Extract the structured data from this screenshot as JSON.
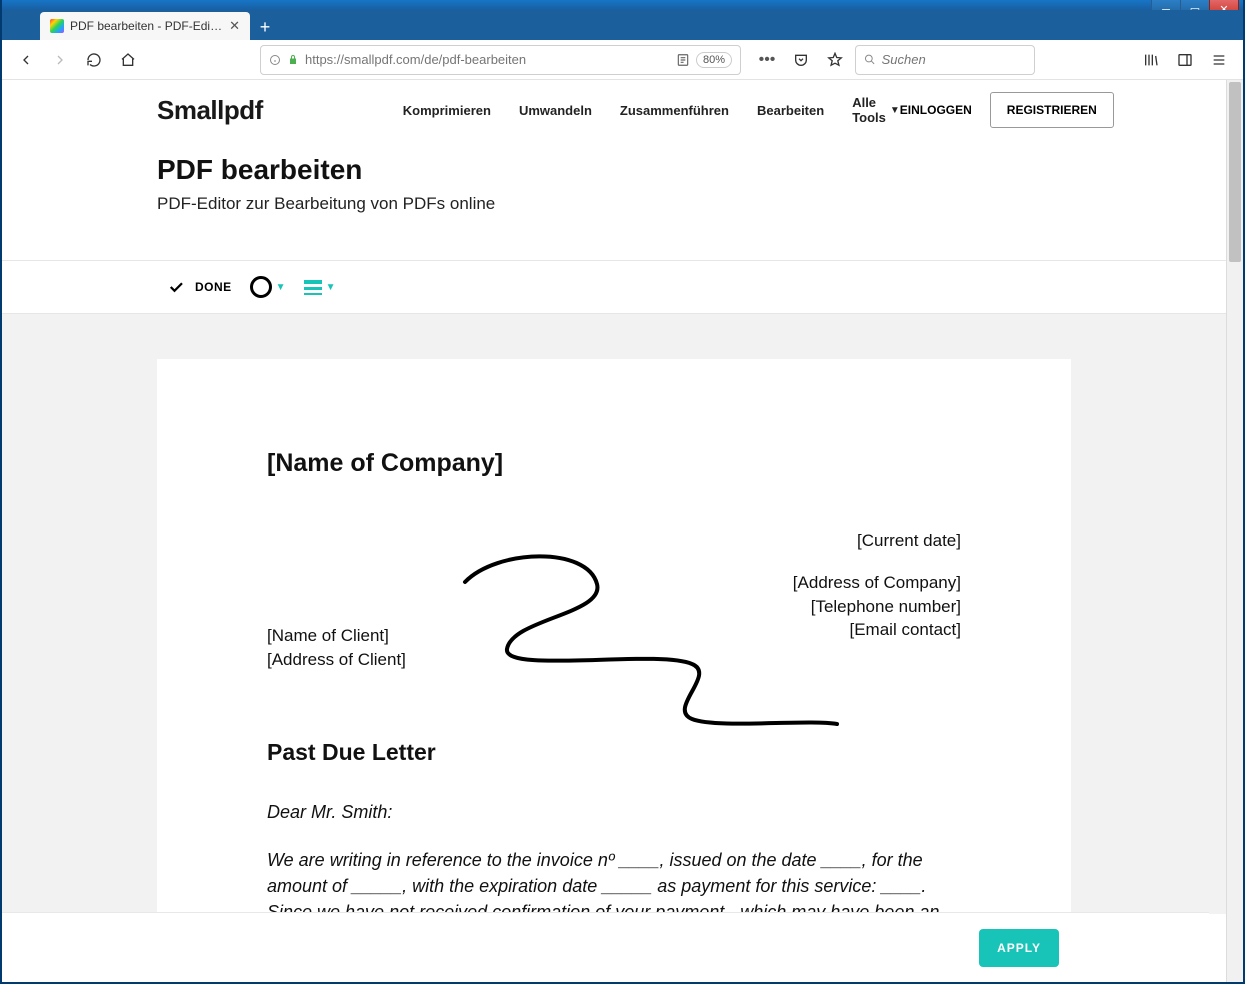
{
  "browser": {
    "tab_title": "PDF bearbeiten - PDF-Editor an",
    "url": "https://smallpdf.com/de/pdf-bearbeiten",
    "zoom": "80%",
    "search_placeholder": "Suchen"
  },
  "header": {
    "logo": "Smallpdf",
    "nav": {
      "komprimieren": "Komprimieren",
      "umwandeln": "Umwandeln",
      "zusammenfuehren": "Zusammenführen",
      "bearbeiten": "Bearbeiten",
      "alletools": "Alle Tools"
    },
    "login": "EINLOGGEN",
    "register": "REGISTRIEREN"
  },
  "page": {
    "title": "PDF bearbeiten",
    "subtitle": "PDF-Editor zur Bearbeitung von PDFs online"
  },
  "toolbar": {
    "done": "DONE"
  },
  "document": {
    "company": "[Name of Company]",
    "current_date": "[Current date]",
    "company_address": "[Address of Company]",
    "telephone": "[Telephone number]",
    "email": "[Email contact]",
    "client_name": "[Name of Client]",
    "client_address": "[Address of Client]",
    "letter_title": "Past Due Letter",
    "greeting": "Dear Mr. Smith:",
    "body": "We are writing in reference to the invoice nº ____, issued on the date ____, for the amount of _____, with the expiration date _____  as payment for this service: ____. Since we have not received confirmation of your payment - which may have been an"
  },
  "footer": {
    "apply": "APPLY"
  }
}
